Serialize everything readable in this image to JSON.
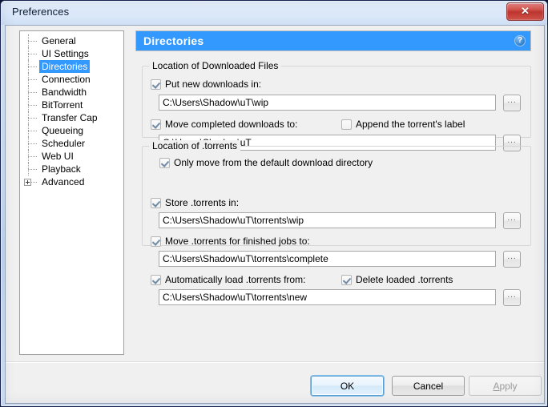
{
  "window": {
    "title": "Preferences",
    "close_label": "✕"
  },
  "sidebar": {
    "items": [
      {
        "label": "General",
        "selected": false,
        "expandable": false
      },
      {
        "label": "UI Settings",
        "selected": false,
        "expandable": false
      },
      {
        "label": "Directories",
        "selected": true,
        "expandable": false
      },
      {
        "label": "Connection",
        "selected": false,
        "expandable": false
      },
      {
        "label": "Bandwidth",
        "selected": false,
        "expandable": false
      },
      {
        "label": "BitTorrent",
        "selected": false,
        "expandable": false
      },
      {
        "label": "Transfer Cap",
        "selected": false,
        "expandable": false
      },
      {
        "label": "Queueing",
        "selected": false,
        "expandable": false
      },
      {
        "label": "Scheduler",
        "selected": false,
        "expandable": false
      },
      {
        "label": "Web UI",
        "selected": false,
        "expandable": false
      },
      {
        "label": "Playback",
        "selected": false,
        "expandable": false
      },
      {
        "label": "Advanced",
        "selected": false,
        "expandable": true
      }
    ]
  },
  "page": {
    "title": "Directories",
    "help_label": "?"
  },
  "groups": {
    "downloads": {
      "legend": "Location of Downloaded Files",
      "put_new_downloads": {
        "label": "Put new downloads in:",
        "checked": true,
        "value": "C:\\Users\\Shadow\\uT\\wip",
        "browse_label": "..."
      },
      "move_completed": {
        "label": "Move completed downloads to:",
        "checked": true,
        "value": "C:\\Users\\Shadow\\uT",
        "browse_label": "..."
      },
      "append_label": {
        "label": "Append the torrent's label",
        "checked": false
      },
      "only_move_default": {
        "label": "Only move from the default download directory",
        "checked": true
      }
    },
    "torrents": {
      "legend": "Location of .torrents",
      "store_torrents": {
        "label": "Store .torrents in:",
        "checked": true,
        "value": "C:\\Users\\Shadow\\uT\\torrents\\wip",
        "browse_label": "..."
      },
      "move_finished": {
        "label": "Move .torrents for finished jobs to:",
        "checked": true,
        "value": "C:\\Users\\Shadow\\uT\\torrents\\complete",
        "browse_label": "..."
      },
      "auto_load": {
        "label": "Automatically load .torrents from:",
        "checked": true,
        "value": "C:\\Users\\Shadow\\uT\\torrents\\new",
        "browse_label": "..."
      },
      "delete_loaded": {
        "label": "Delete loaded .torrents",
        "checked": true
      }
    }
  },
  "buttons": {
    "ok": "OK",
    "cancel": "Cancel",
    "apply_accel": "A",
    "apply_rest": "pply"
  },
  "colors": {
    "accent": "#3399ff",
    "selection": "#3399ff",
    "close_red": "#bf352e"
  }
}
